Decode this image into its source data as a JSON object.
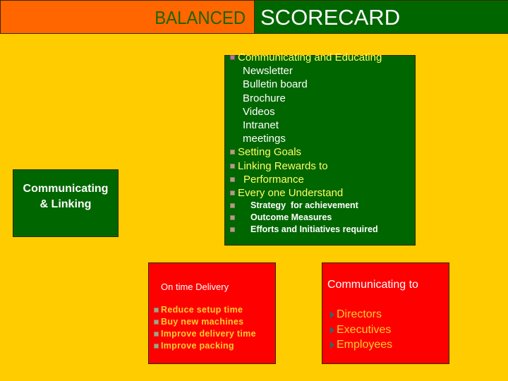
{
  "header": {
    "title_left": "BALANCED",
    "title_right": "SCORECARD"
  },
  "colors": {
    "background": "#FFCC00",
    "header_left": "#FF6600",
    "header_right": "#006600",
    "green_box": "#006600",
    "red_box": "#FF0000",
    "heading_text": "#FFFF66",
    "bullet_text": "#FFCC33"
  },
  "left_box": {
    "line1": "Communicating",
    "line2": "& Linking"
  },
  "main_box": {
    "items": [
      {
        "type": "head",
        "text": "Communicating and Educating",
        "bullet": "square-bullet-icon"
      },
      {
        "type": "sub",
        "text": "Newsletter"
      },
      {
        "type": "sub",
        "text": "Bulletin board"
      },
      {
        "type": "sub",
        "text": "Brochure"
      },
      {
        "type": "sub",
        "text": "Videos"
      },
      {
        "type": "sub",
        "text": "Intranet"
      },
      {
        "type": "sub",
        "text": "meetings"
      },
      {
        "type": "head",
        "text": "Setting Goals",
        "bullet": "square-bullet-icon"
      },
      {
        "type": "head",
        "text": "Linking Rewards to",
        "bullet": "square-bullet-icon"
      },
      {
        "type": "cont",
        "text": "Performance",
        "bullet": "square-bullet-icon"
      },
      {
        "type": "head",
        "text": "Every one Understand",
        "bullet": "square-bullet-icon"
      },
      {
        "type": "small",
        "text": "Strategy  for achievement",
        "bullet": "square-bullet-icon"
      },
      {
        "type": "small",
        "text": "Outcome Measures",
        "bullet": "square-bullet-icon"
      },
      {
        "type": "small",
        "text": "Efforts and Initiatives required",
        "bullet": "square-bullet-icon"
      }
    ]
  },
  "delivery_box": {
    "title": "On time Delivery",
    "items": [
      "Reduce setup time",
      "Buy new machines",
      "Improve delivery time",
      "Improve packing"
    ]
  },
  "communicating_box": {
    "title": "Communicating to",
    "items": [
      "Directors",
      "Executives",
      "Employees"
    ]
  }
}
